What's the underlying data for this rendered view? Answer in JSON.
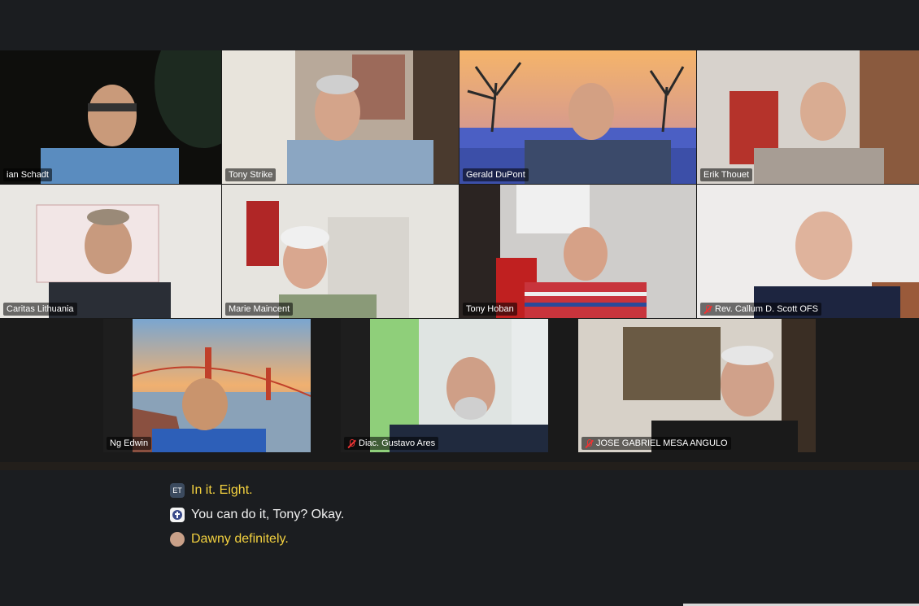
{
  "participants": [
    {
      "name": "ian Schadt",
      "muted": false,
      "active": false
    },
    {
      "name": "Tony Strike",
      "muted": false,
      "active": false
    },
    {
      "name": "Gerald DuPont",
      "muted": false,
      "active": false
    },
    {
      "name": "Erik  Thouet",
      "muted": false,
      "active": true
    },
    {
      "name": "Caritas Lithuania",
      "muted": false,
      "active": false
    },
    {
      "name": "Marie Maincent",
      "muted": false,
      "active": false
    },
    {
      "name": "Tony Hoban",
      "muted": false,
      "active": false
    },
    {
      "name": "Rev. Callum D. Scott OFS",
      "muted": true,
      "active": false
    },
    {
      "name": "Ng Edwin",
      "muted": false,
      "active": false
    },
    {
      "name": "Diac. Gustavo Ares",
      "muted": true,
      "active": false
    },
    {
      "name": "JOSE GABRIEL MESA ANGULO",
      "muted": true,
      "active": false
    }
  ],
  "captions": [
    {
      "avatar": "ET",
      "text": "In it. Eight.",
      "color": "#f3d13f"
    },
    {
      "avatar": "",
      "text": "You can do it, Tony? Okay.",
      "color": "#f2f2f2"
    },
    {
      "avatar": "",
      "text": "Dawny definitely.",
      "color": "#f3d13f"
    }
  ],
  "colors": {
    "active_speaker_border": "#2fd58b",
    "caption_highlight": "#f3d13f",
    "mute_icon": "#e33333"
  }
}
